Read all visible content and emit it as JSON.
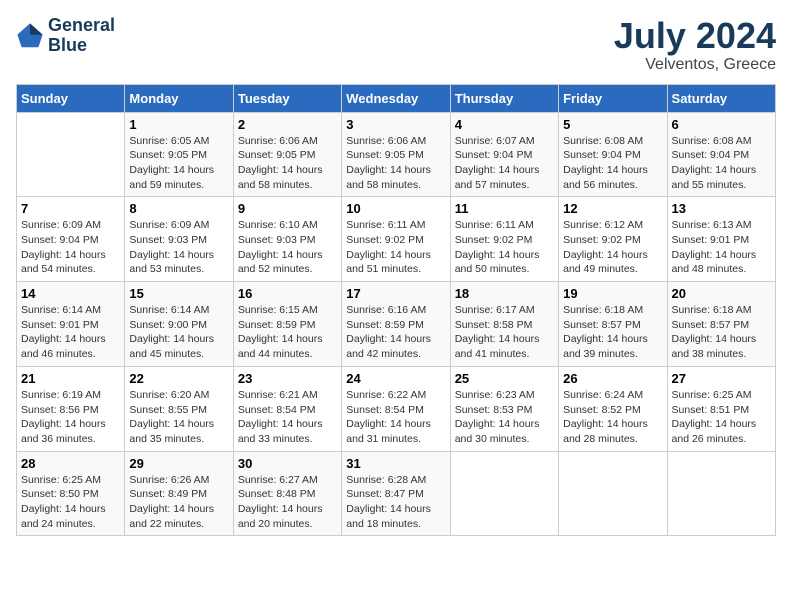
{
  "logo": {
    "line1": "General",
    "line2": "Blue"
  },
  "title": "July 2024",
  "location": "Velventos, Greece",
  "days_of_week": [
    "Sunday",
    "Monday",
    "Tuesday",
    "Wednesday",
    "Thursday",
    "Friday",
    "Saturday"
  ],
  "weeks": [
    [
      {
        "day": "",
        "info": ""
      },
      {
        "day": "1",
        "info": "Sunrise: 6:05 AM\nSunset: 9:05 PM\nDaylight: 14 hours\nand 59 minutes."
      },
      {
        "day": "2",
        "info": "Sunrise: 6:06 AM\nSunset: 9:05 PM\nDaylight: 14 hours\nand 58 minutes."
      },
      {
        "day": "3",
        "info": "Sunrise: 6:06 AM\nSunset: 9:05 PM\nDaylight: 14 hours\nand 58 minutes."
      },
      {
        "day": "4",
        "info": "Sunrise: 6:07 AM\nSunset: 9:04 PM\nDaylight: 14 hours\nand 57 minutes."
      },
      {
        "day": "5",
        "info": "Sunrise: 6:08 AM\nSunset: 9:04 PM\nDaylight: 14 hours\nand 56 minutes."
      },
      {
        "day": "6",
        "info": "Sunrise: 6:08 AM\nSunset: 9:04 PM\nDaylight: 14 hours\nand 55 minutes."
      }
    ],
    [
      {
        "day": "7",
        "info": "Sunrise: 6:09 AM\nSunset: 9:04 PM\nDaylight: 14 hours\nand 54 minutes."
      },
      {
        "day": "8",
        "info": "Sunrise: 6:09 AM\nSunset: 9:03 PM\nDaylight: 14 hours\nand 53 minutes."
      },
      {
        "day": "9",
        "info": "Sunrise: 6:10 AM\nSunset: 9:03 PM\nDaylight: 14 hours\nand 52 minutes."
      },
      {
        "day": "10",
        "info": "Sunrise: 6:11 AM\nSunset: 9:02 PM\nDaylight: 14 hours\nand 51 minutes."
      },
      {
        "day": "11",
        "info": "Sunrise: 6:11 AM\nSunset: 9:02 PM\nDaylight: 14 hours\nand 50 minutes."
      },
      {
        "day": "12",
        "info": "Sunrise: 6:12 AM\nSunset: 9:02 PM\nDaylight: 14 hours\nand 49 minutes."
      },
      {
        "day": "13",
        "info": "Sunrise: 6:13 AM\nSunset: 9:01 PM\nDaylight: 14 hours\nand 48 minutes."
      }
    ],
    [
      {
        "day": "14",
        "info": "Sunrise: 6:14 AM\nSunset: 9:01 PM\nDaylight: 14 hours\nand 46 minutes."
      },
      {
        "day": "15",
        "info": "Sunrise: 6:14 AM\nSunset: 9:00 PM\nDaylight: 14 hours\nand 45 minutes."
      },
      {
        "day": "16",
        "info": "Sunrise: 6:15 AM\nSunset: 8:59 PM\nDaylight: 14 hours\nand 44 minutes."
      },
      {
        "day": "17",
        "info": "Sunrise: 6:16 AM\nSunset: 8:59 PM\nDaylight: 14 hours\nand 42 minutes."
      },
      {
        "day": "18",
        "info": "Sunrise: 6:17 AM\nSunset: 8:58 PM\nDaylight: 14 hours\nand 41 minutes."
      },
      {
        "day": "19",
        "info": "Sunrise: 6:18 AM\nSunset: 8:57 PM\nDaylight: 14 hours\nand 39 minutes."
      },
      {
        "day": "20",
        "info": "Sunrise: 6:18 AM\nSunset: 8:57 PM\nDaylight: 14 hours\nand 38 minutes."
      }
    ],
    [
      {
        "day": "21",
        "info": "Sunrise: 6:19 AM\nSunset: 8:56 PM\nDaylight: 14 hours\nand 36 minutes."
      },
      {
        "day": "22",
        "info": "Sunrise: 6:20 AM\nSunset: 8:55 PM\nDaylight: 14 hours\nand 35 minutes."
      },
      {
        "day": "23",
        "info": "Sunrise: 6:21 AM\nSunset: 8:54 PM\nDaylight: 14 hours\nand 33 minutes."
      },
      {
        "day": "24",
        "info": "Sunrise: 6:22 AM\nSunset: 8:54 PM\nDaylight: 14 hours\nand 31 minutes."
      },
      {
        "day": "25",
        "info": "Sunrise: 6:23 AM\nSunset: 8:53 PM\nDaylight: 14 hours\nand 30 minutes."
      },
      {
        "day": "26",
        "info": "Sunrise: 6:24 AM\nSunset: 8:52 PM\nDaylight: 14 hours\nand 28 minutes."
      },
      {
        "day": "27",
        "info": "Sunrise: 6:25 AM\nSunset: 8:51 PM\nDaylight: 14 hours\nand 26 minutes."
      }
    ],
    [
      {
        "day": "28",
        "info": "Sunrise: 6:25 AM\nSunset: 8:50 PM\nDaylight: 14 hours\nand 24 minutes."
      },
      {
        "day": "29",
        "info": "Sunrise: 6:26 AM\nSunset: 8:49 PM\nDaylight: 14 hours\nand 22 minutes."
      },
      {
        "day": "30",
        "info": "Sunrise: 6:27 AM\nSunset: 8:48 PM\nDaylight: 14 hours\nand 20 minutes."
      },
      {
        "day": "31",
        "info": "Sunrise: 6:28 AM\nSunset: 8:47 PM\nDaylight: 14 hours\nand 18 minutes."
      },
      {
        "day": "",
        "info": ""
      },
      {
        "day": "",
        "info": ""
      },
      {
        "day": "",
        "info": ""
      }
    ]
  ]
}
